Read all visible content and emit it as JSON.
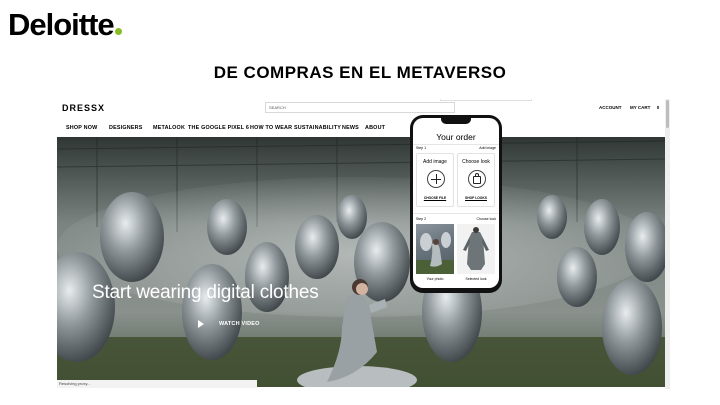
{
  "slide": {
    "logo_text": "Deloitte",
    "title": "DE COMPRAS EN EL METAVERSO",
    "brand_color": "#86bc25"
  },
  "site": {
    "brand": "DRESSX",
    "search_placeholder": "SEARCH",
    "account": "ACCOUNT",
    "cart": "MY CART",
    "cart_count": "0",
    "nav": [
      "SHOP NOW",
      "DESIGNERS",
      "METALOOK",
      "THE GOOGLE PIXEL 6",
      "HOW TO WEAR",
      "SUSTAINABILITY",
      "NEWS",
      "ABOUT"
    ],
    "hero_title": "Start wearing digital clothes",
    "watch_video": "WATCH VIDEO",
    "status_text": "Resolving proxy..."
  },
  "phone": {
    "order_title": "Your order",
    "step1_label": "Step 1",
    "step1_right": "Add image",
    "card_left_title": "Add image",
    "card_left_link": "CHOOSE FILE",
    "card_right_title": "Choose look",
    "card_right_link": "SHOP LOOKS",
    "step2_label": "Step 2",
    "step2_right": "Choose look",
    "photo_caption": "Your photo",
    "look_caption": "Selected look"
  },
  "icons": [
    "plus-icon",
    "shopping-bag-icon",
    "play-icon"
  ]
}
